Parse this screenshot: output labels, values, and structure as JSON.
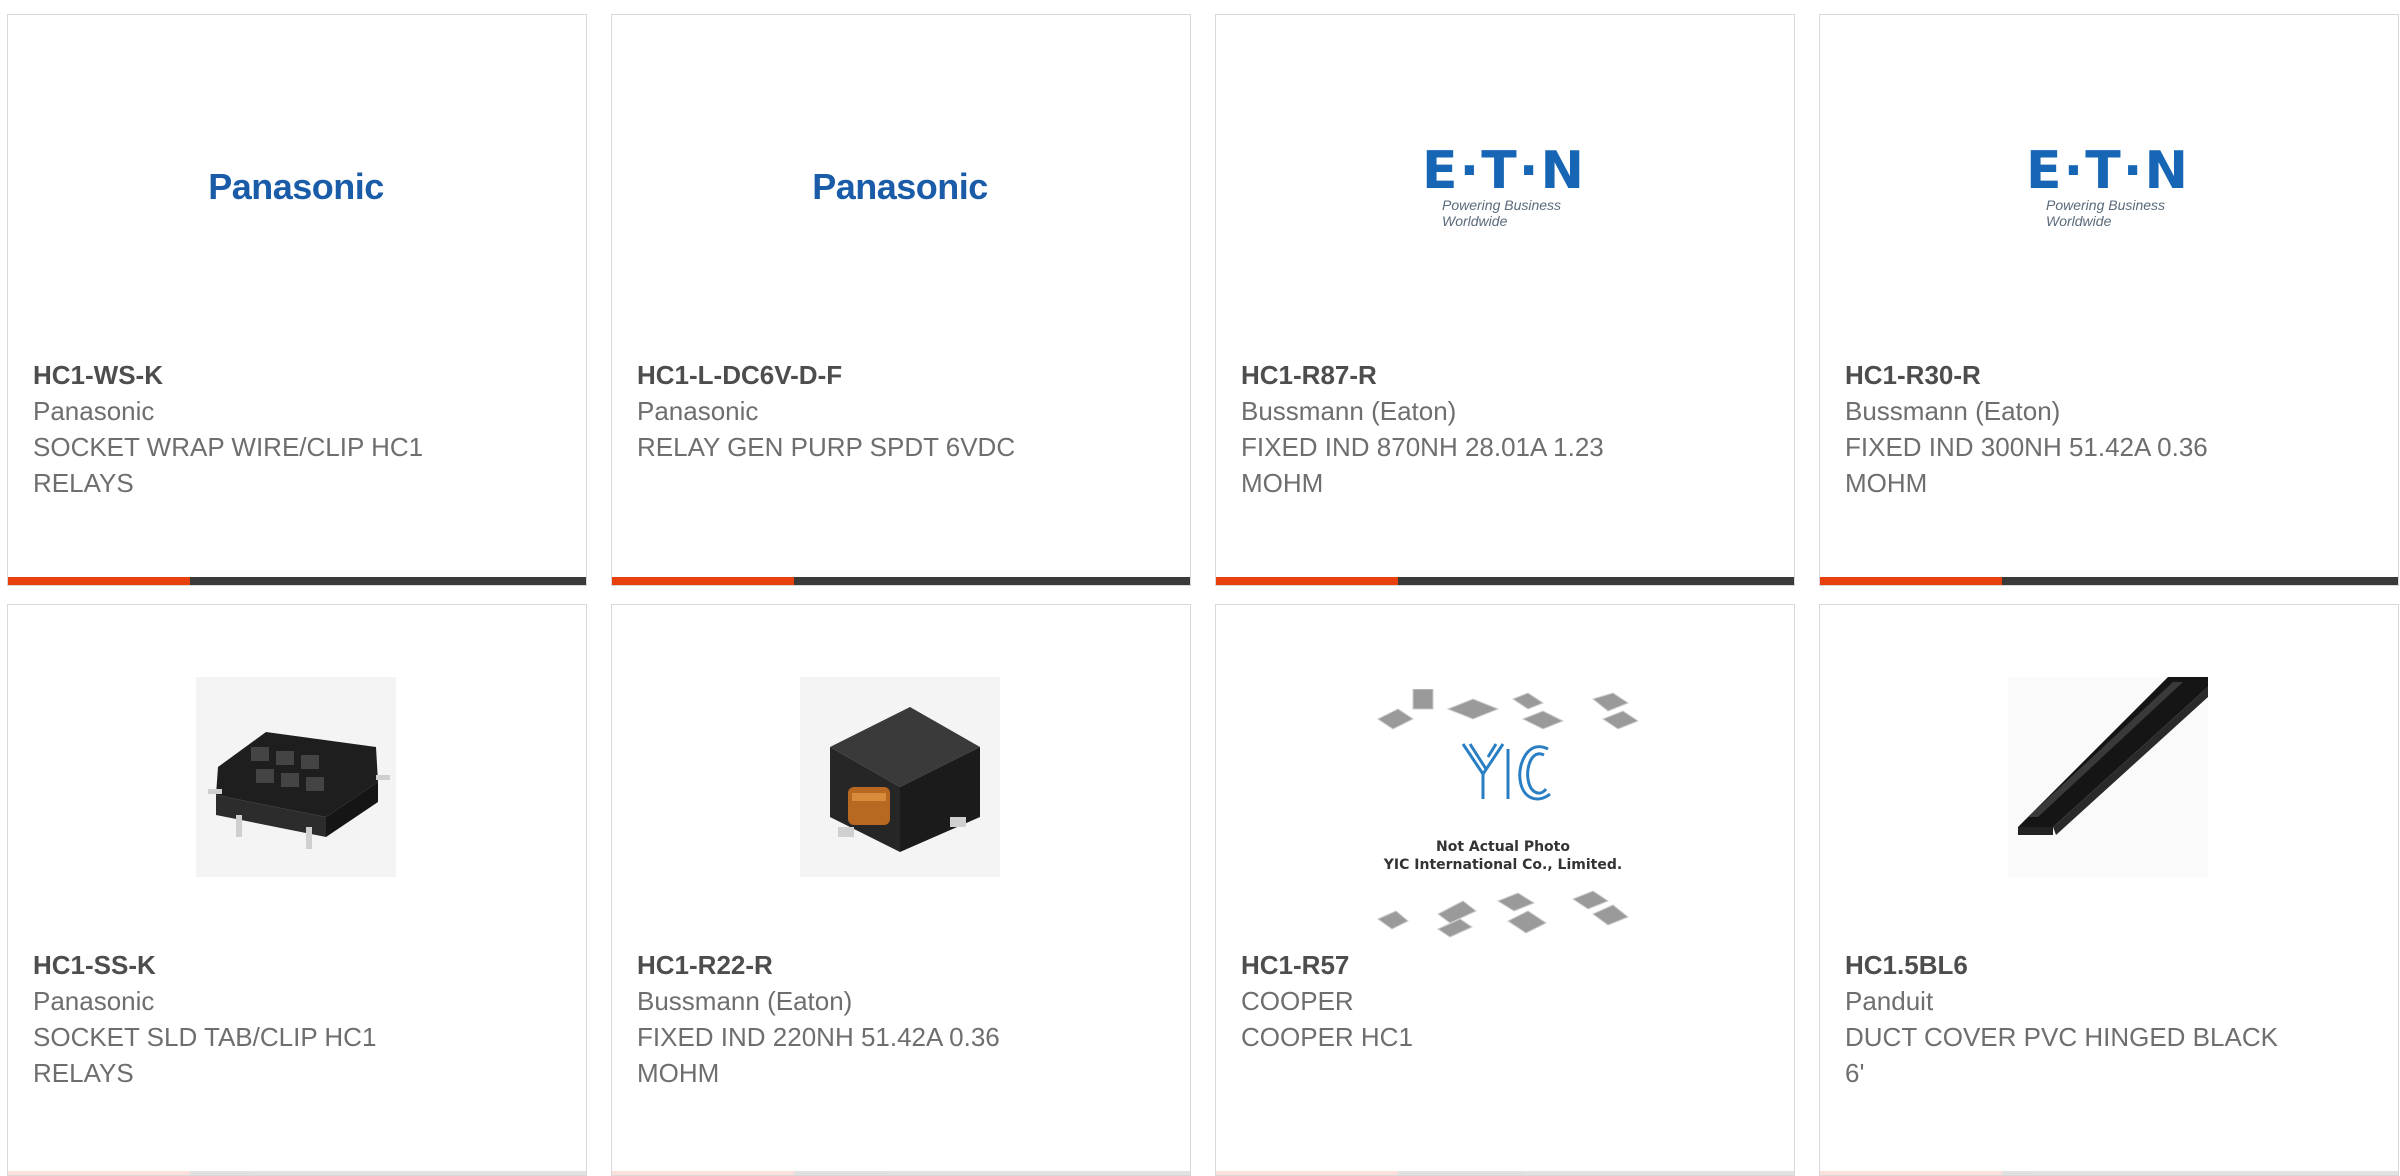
{
  "colors": {
    "accent": "#e8400c",
    "bar": "#3a3a3a",
    "panasonic_blue": "#1a5ca8",
    "eaton_blue": "#1666b5"
  },
  "products": [
    {
      "part_number": "HC1-WS-K",
      "manufacturer": "Panasonic",
      "description": "SOCKET WRAP WIRE/CLIP HC1 RELAYS",
      "image": "panasonic-logo",
      "logo_text": "Panasonic"
    },
    {
      "part_number": "HC1-L-DC6V-D-F",
      "manufacturer": "Panasonic",
      "description": "RELAY GEN PURP SPDT 6VDC",
      "image": "panasonic-logo",
      "logo_text": "Panasonic"
    },
    {
      "part_number": "HC1-R87-R",
      "manufacturer": "Bussmann (Eaton)",
      "description": "FIXED IND 870NH 28.01A 1.23 MOHM",
      "image": "eaton-logo",
      "logo_text": "E·T·N",
      "logo_tagline": "Powering Business Worldwide"
    },
    {
      "part_number": "HC1-R30-R",
      "manufacturer": "Bussmann (Eaton)",
      "description": "FIXED IND 300NH 51.42A 0.36 MOHM",
      "image": "eaton-logo",
      "logo_text": "E·T·N",
      "logo_tagline": "Powering Business Worldwide"
    },
    {
      "part_number": "HC1-SS-K",
      "manufacturer": "Panasonic",
      "description": "SOCKET SLD TAB/CLIP HC1 RELAYS",
      "image": "relay-socket-photo"
    },
    {
      "part_number": "HC1-R22-R",
      "manufacturer": "Bussmann (Eaton)",
      "description": "FIXED IND 220NH 51.42A 0.36 MOHM",
      "image": "inductor-photo"
    },
    {
      "part_number": "HC1-R57",
      "manufacturer": "COOPER",
      "description": "COOPER HC1",
      "image": "yic-placeholder",
      "placeholder_line1": "Not Actual Photo",
      "placeholder_line2": "YIC International Co., Limited."
    },
    {
      "part_number": "HC1.5BL6",
      "manufacturer": "Panduit",
      "description": "DUCT COVER PVC HINGED BLACK 6'",
      "image": "duct-cover-photo"
    }
  ]
}
